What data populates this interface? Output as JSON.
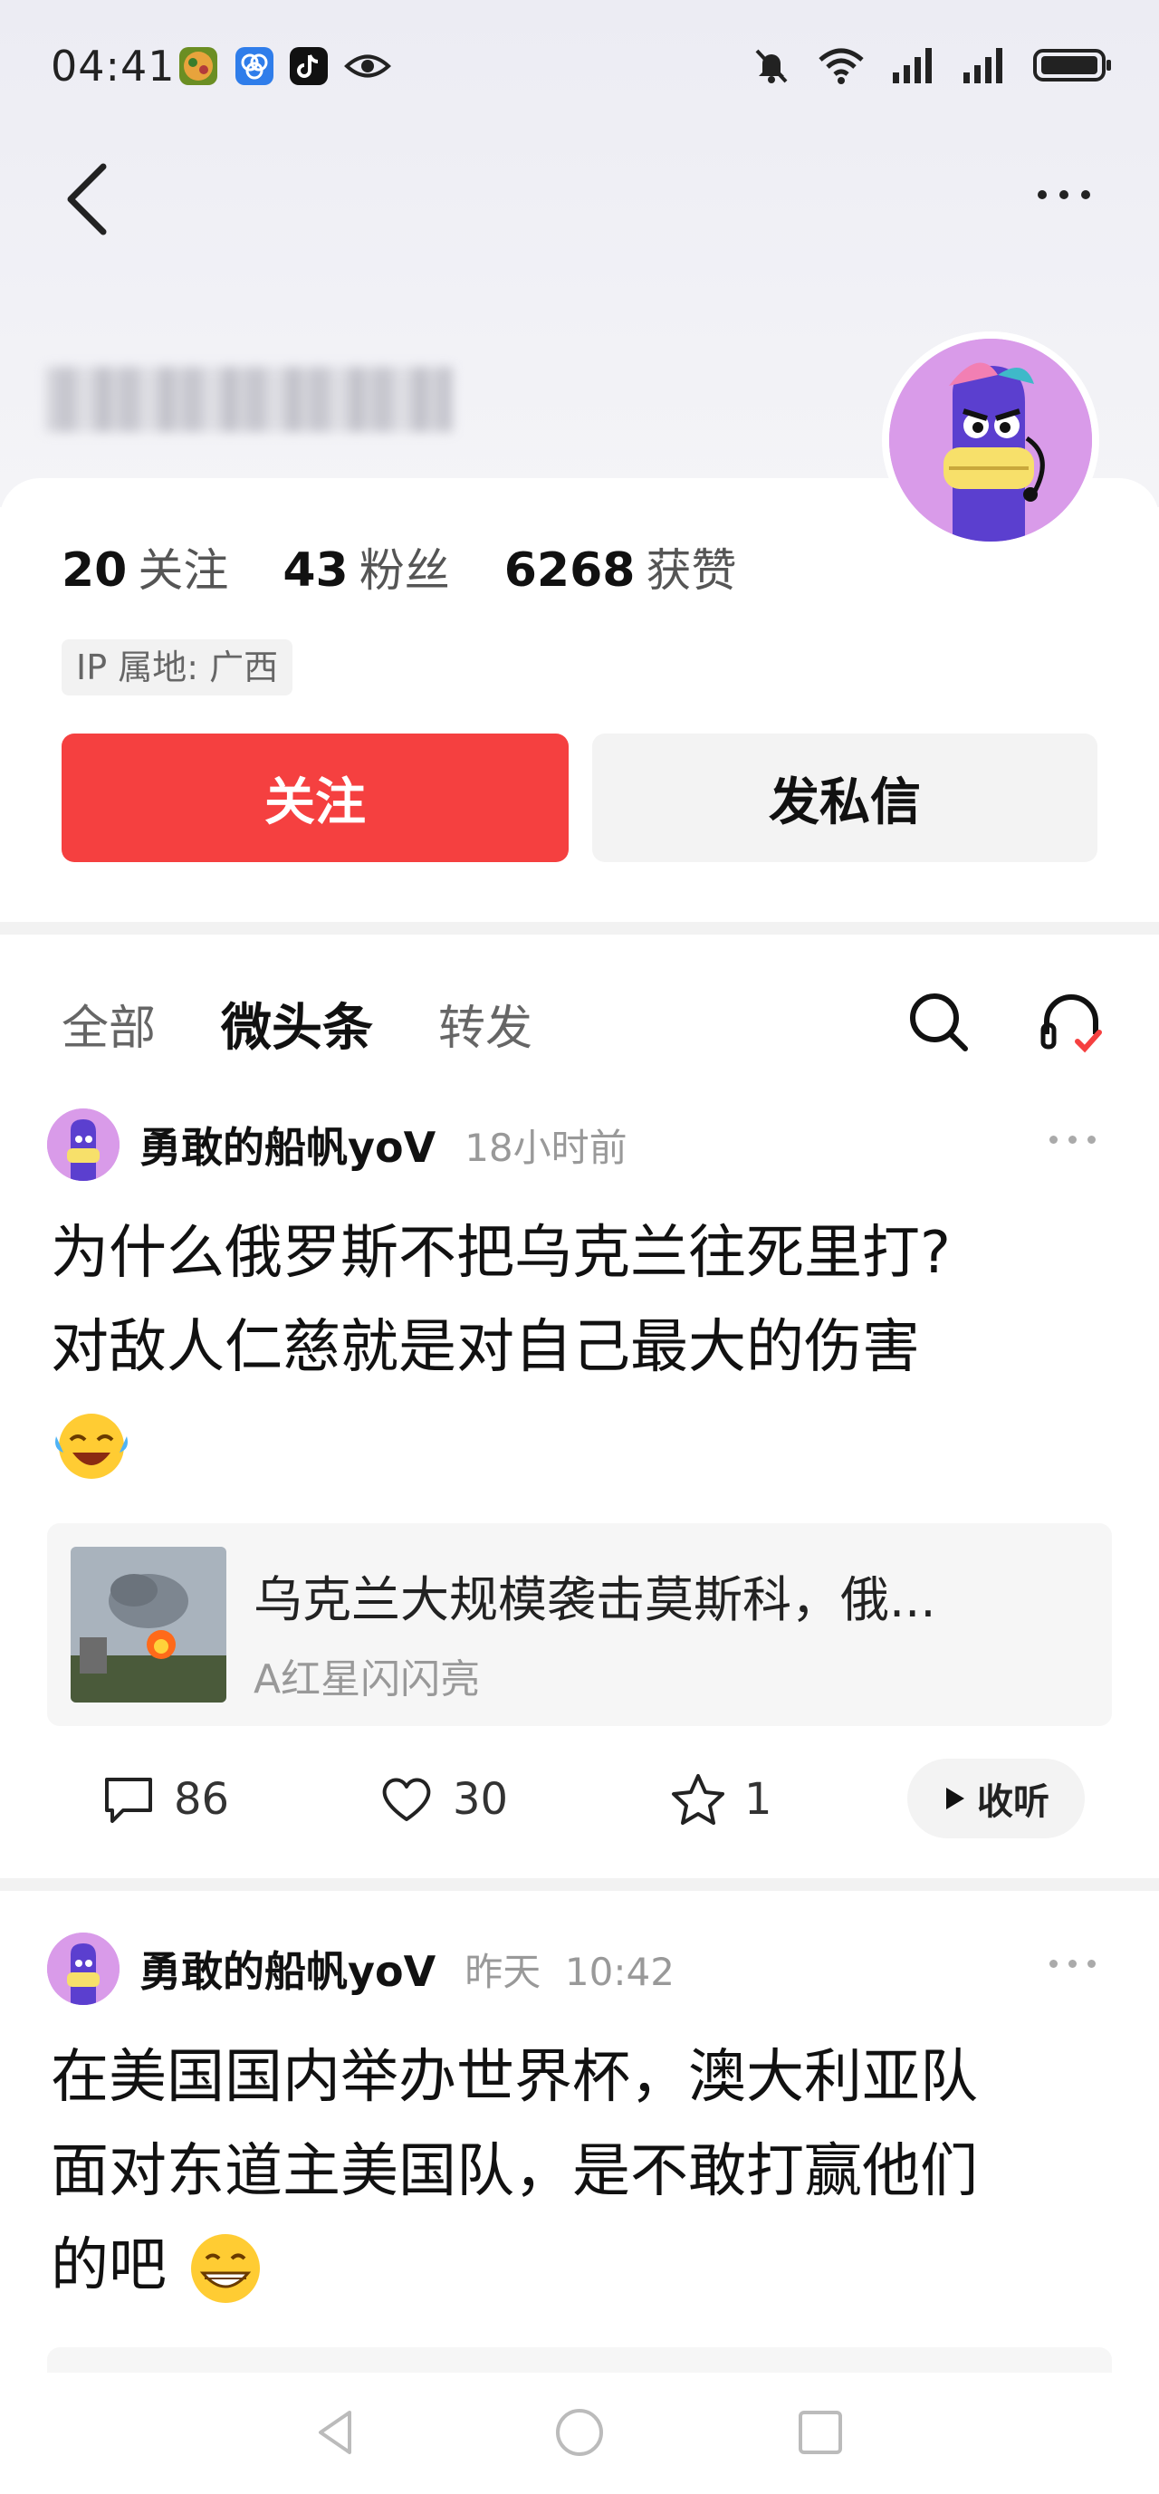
{
  "status_bar": {
    "time": "04:41",
    "icons": [
      "game-app-icon",
      "link-app-icon",
      "tiktok-icon",
      "eye-icon",
      "mute-icon",
      "wifi-icon",
      "signal-icon",
      "signal-icon",
      "battery-icon"
    ]
  },
  "header": {
    "back_icon": "chevron-left-icon",
    "more_icon": "more-dots-icon"
  },
  "profile": {
    "stats": [
      {
        "num": "20",
        "label": "关注"
      },
      {
        "num": "43",
        "label": "粉丝"
      },
      {
        "num": "6268",
        "label": "获赞"
      }
    ],
    "ip": "IP 属地: 广西",
    "follow_label": "关注",
    "dm_label": "发私信",
    "accent": "#f54040"
  },
  "tabs": [
    {
      "label": "全部",
      "active": false
    },
    {
      "label": "微头条",
      "active": true
    },
    {
      "label": "转发",
      "active": false
    }
  ],
  "posts": [
    {
      "author": "勇敢的船帆yoV",
      "time": "18小时前",
      "text_lines": [
        "为什么俄罗斯不把乌克兰往死里打?",
        "对敌人仁慈就是对自己最大的伤害"
      ],
      "emoji": "laughing-tears-emoji",
      "link_title": "乌克兰大规模袭击莫斯科，俄...",
      "link_source": "A红星闪闪亮",
      "comments": "86",
      "likes": "30",
      "favorites": "1",
      "listen_label": "收听"
    },
    {
      "author": "勇敢的船帆yoV",
      "time": "昨天  10:42",
      "text_lines": [
        "在美国国内举办世界杯，澳大利亚队",
        "面对东道主美国队，是不敢打赢他们",
        "的吧"
      ],
      "emoji": "grinning-emoji"
    }
  ]
}
